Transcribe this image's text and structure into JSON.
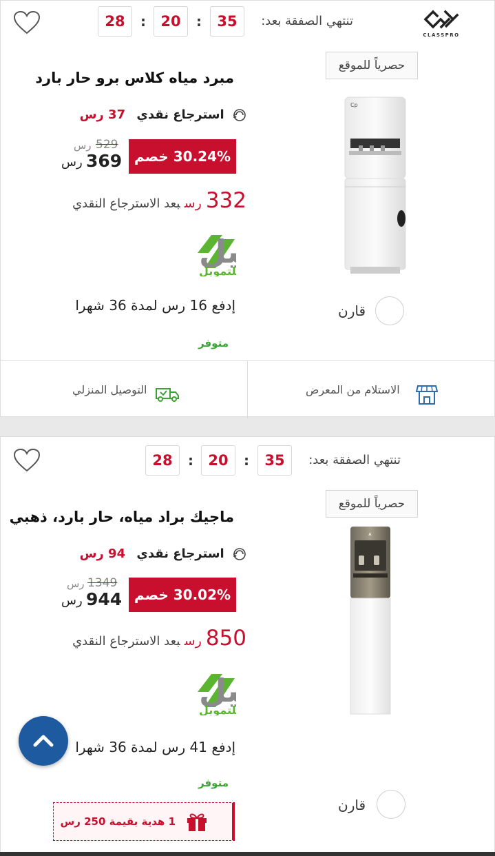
{
  "brand": {
    "logo_text": "CLASSPRO"
  },
  "products": [
    {
      "timer": {
        "label": "تنتهي الصفقة بعد:",
        "seconds": "35",
        "minutes": "20",
        "hours": "28"
      },
      "exclusive_label": "حصرياً للموقع",
      "title": "مبرد مياه كلاس برو حار بارد",
      "cashback_label": "استرجاع نقدي",
      "cashback_value": "37 رس",
      "discount_label": "30.24% خصم",
      "old_price": "529",
      "old_price_currency": "رس",
      "new_price": "369",
      "new_price_currency": "رس",
      "after_cashback_amount": "332",
      "after_cashback_currency": "رس",
      "after_cashback_label": "بعد الاسترجاع النقدي",
      "financing_brand": "تسهيل",
      "financing_sub": "للتمويل",
      "installment_text": "إدفع 16 رس  لمدة 36 شهرا",
      "availability": "متوفر",
      "compare_label": "قارن",
      "delivery_home": "التوصيل المنزلي",
      "delivery_pickup": "الاستلام من المعرض"
    },
    {
      "timer": {
        "label": "تنتهي الصفقة بعد:",
        "seconds": "35",
        "minutes": "20",
        "hours": "28"
      },
      "exclusive_label": "حصرياً للموقع",
      "title": "ماجيك براد مياه، حار بارد، ذهبي",
      "cashback_label": "استرجاع نقدي",
      "cashback_value": "94 رس",
      "discount_label": "30.02% خصم",
      "old_price": "1349",
      "old_price_currency": "رس",
      "new_price": "944",
      "new_price_currency": "رس",
      "after_cashback_amount": "850",
      "after_cashback_currency": "رس",
      "after_cashback_label": "بعد الاسترجاع النقدي",
      "financing_brand": "تسهيل",
      "financing_sub": "للتمويل",
      "installment_text": "إدفع 41 رس  لمدة 36 شهرا",
      "availability": "متوفر",
      "compare_label": "قارن",
      "gift_text": "1 هدية بقيمة 250 رس"
    }
  ],
  "colors": {
    "accent_red": "#c8102e",
    "success_green": "#3aa535",
    "scroll_button": "#1e5aa0"
  }
}
